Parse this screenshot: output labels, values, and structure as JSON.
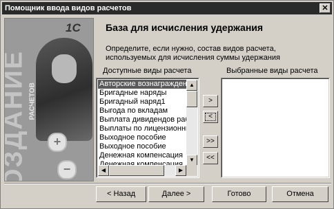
{
  "window": {
    "title": "Помощник ввода видов расчетов",
    "close_label": "✕"
  },
  "sidebar": {
    "logo": "1С",
    "big_text": "СОЗДАНИЕ",
    "sub_text": "РАСЧЕТОВ"
  },
  "heading": "База для исчисления удержания",
  "description": "Определите, если нужно, состав видов расчета, используемых для исчисления суммы удержания",
  "available": {
    "label": "Доступные виды расчета",
    "items": [
      "Авторские вознаграждения",
      "Бригадные наряды",
      "Бригадный наряд1",
      "Выгода по вкладам",
      "Выплата дивидендов работникам",
      "Выплаты по лицензионным договорам",
      "Выходное пособие",
      "Выходное пособие",
      "Денежная компенсация",
      "Денежная компенсация"
    ],
    "selected_index": 0
  },
  "selected": {
    "label": "Выбранные виды расчета",
    "items": []
  },
  "move_buttons": {
    "add_one": ">",
    "remove_one": "<",
    "add_all": ">>",
    "remove_all": "<<"
  },
  "footer": {
    "back": "< Назад",
    "next": "Далее >",
    "finish": "Готово",
    "cancel": "Отмена"
  }
}
